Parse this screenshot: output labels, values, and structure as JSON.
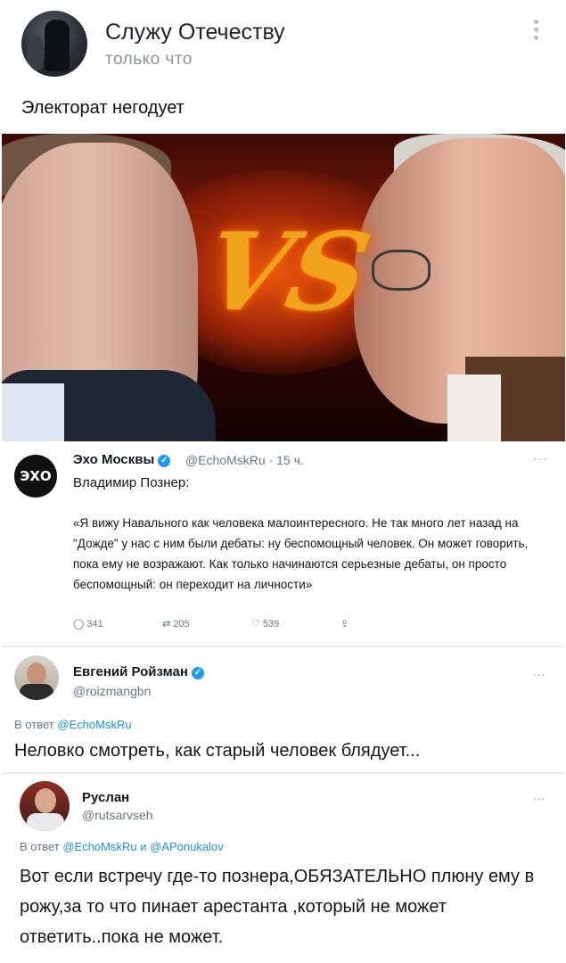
{
  "post": {
    "channel_name": "Служу Отечеству",
    "time": "только что",
    "text": "Электорат негодует",
    "image_vs_text": "VS"
  },
  "tweet_echo": {
    "name": "Эхо Москвы",
    "handle": "@EchoMskRu · 15 ч.",
    "avatar_text": "ЭХО",
    "line1": "Владимир Познер:",
    "quote": "«Я вижу Навального как человека малоинтересного. Не так много лет назад на \"Дожде\" у нас с ним были дебаты: ну беспомощный человек. Он может говорить, пока ему не возражают. Как только начинаются серьезные дебаты, он просто беспомощный: он переходит на личности»",
    "replies": "341",
    "retweets": "205",
    "likes": "539",
    "dots": "..."
  },
  "tweet_roizman": {
    "name": "Евгений Ройзман",
    "handle": "@roizmangbn",
    "reply_prefix": "В ответ",
    "reply_to": "@EchoMskRu",
    "text": "Неловко смотреть, как старый человек блядует...",
    "dots": "..."
  },
  "tweet_ruslan": {
    "name": "Руслан",
    "handle": "@rutsarvseh",
    "reply_prefix": "В ответ",
    "reply_to": "@EchoMskRu и @APonukalov",
    "text": "Вот если встречу где-то познера,ОБЯЗАТЕЛЬНО плюну ему в рожу,за то что пинает арестанта ,который не может ответить..пока не может.",
    "dots": "..."
  },
  "colors": {
    "link": "#1b95e0",
    "verified": "#1d9bf0",
    "secondary_text": "#657786"
  },
  "icons": [
    "menu-dots-icon",
    "verified-icon",
    "reply-icon",
    "retweet-icon",
    "like-icon",
    "share-icon"
  ]
}
